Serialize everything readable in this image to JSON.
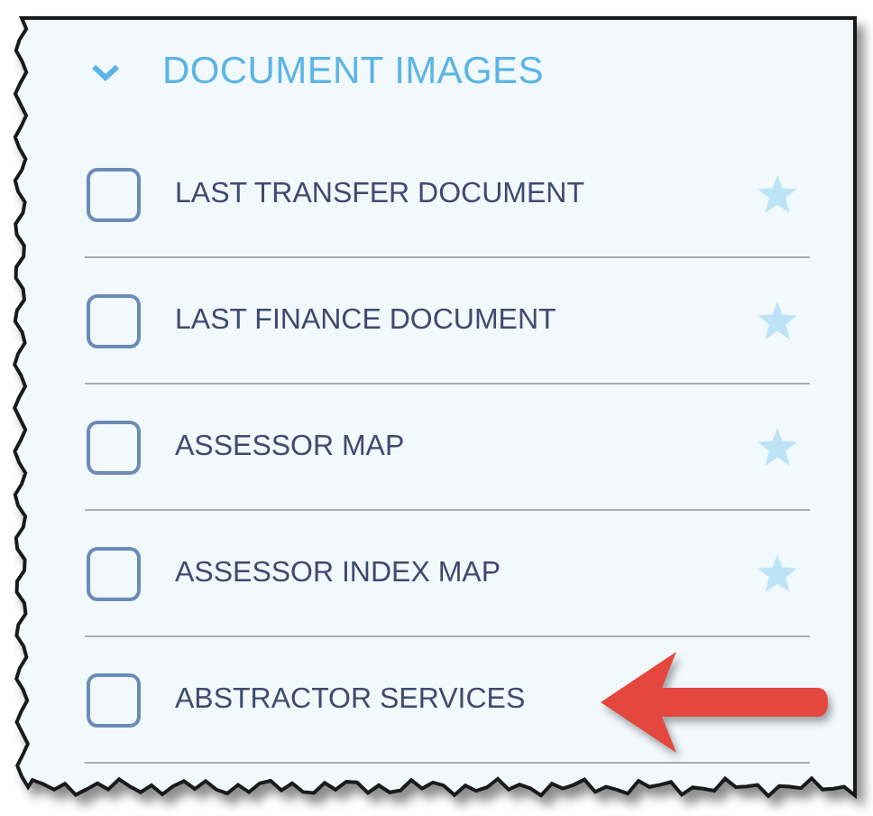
{
  "section": {
    "title": "DOCUMENT IMAGES",
    "expanded": true
  },
  "items": [
    {
      "label": "LAST TRANSFER DOCUMENT",
      "checked": false,
      "kind": "favorite"
    },
    {
      "label": "LAST FINANCE DOCUMENT",
      "checked": false,
      "kind": "favorite"
    },
    {
      "label": "ASSESSOR MAP",
      "checked": false,
      "kind": "favorite"
    },
    {
      "label": "ASSESSOR INDEX MAP",
      "checked": false,
      "kind": "favorite"
    },
    {
      "label": "ABSTRACTOR SERVICES",
      "checked": false,
      "kind": "pointed"
    }
  ]
}
